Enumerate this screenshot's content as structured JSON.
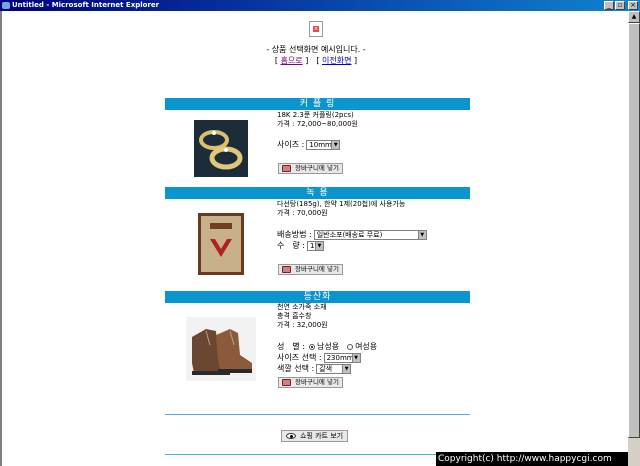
{
  "window": {
    "title": "Untitled - Microsoft Internet Explorer",
    "buttons": [
      "_",
      "▫",
      "×"
    ]
  },
  "header": {
    "intro": "- 상품 선택화면 예시입니다. -",
    "home_link": "홈으로",
    "prev_link": "이전화면"
  },
  "products": [
    {
      "title": "커 플 링",
      "lines": [
        "18K 2.3푼 커플링(2pcs)",
        "가격 : 72,000~80,000원"
      ],
      "option_label": "사이즈 :",
      "option_value": "10mm",
      "cart_label": "장바구니에 넣기"
    },
    {
      "title": "녹 용",
      "lines": [
        "다선탕(185g), 한약 1제(20첩)에 사용가능",
        "가격 : 70,000원"
      ],
      "option_label": "배송방법 :",
      "option_value": "일반소포(배송료 무료)",
      "qty_label": "수　량 :",
      "qty_value": "1",
      "cart_label": "장바구니에 넣기"
    },
    {
      "title": "등산화",
      "lines": [
        "천연 소가죽 소재",
        "충격 흡수창",
        "가격 : 32,000원"
      ],
      "gender_label": "성　별 :",
      "gender_options": [
        "남성용",
        "여성용"
      ],
      "gender_selected": 0,
      "size_label": "사이즈 선택 :",
      "size_value": "230mm",
      "color_label": "색깔 선택 :",
      "color_value": "갈색",
      "cart_label": "장바구니에 넣기"
    }
  ],
  "footer": {
    "shop_cart_label": "쇼핑 카트 보기",
    "copyright": "Copyright(c) http://www.happycgi.com"
  },
  "colors": {
    "section_bar": "#0b95cf",
    "titlebar": "#000080"
  }
}
